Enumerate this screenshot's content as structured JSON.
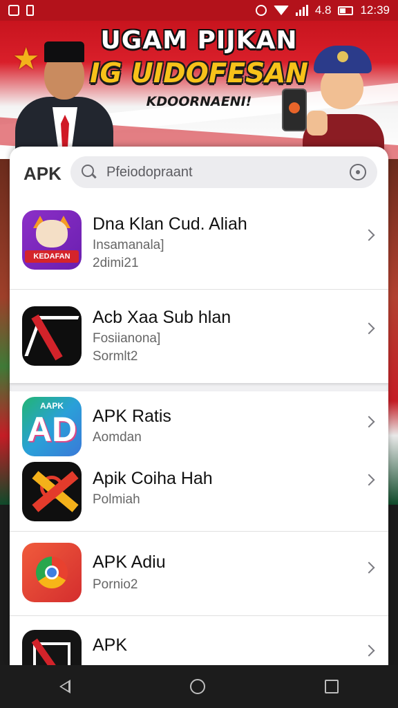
{
  "status_bar": {
    "battery_text": "4.8",
    "time": "12:39"
  },
  "banner": {
    "title": "UGAM PIJKAN",
    "subtitle": "IG UIDOFESAN",
    "tagline": "KDOORNAENI!"
  },
  "search": {
    "brand": "APK",
    "placeholder": "Pfeiodopraant"
  },
  "apps": [
    {
      "title": "Dna Klan Cud. Aliah",
      "line1": "Insamanala]",
      "line2": "2dimi21",
      "icon": "cat-mascot-icon",
      "icon_label": "KEDAFAN"
    },
    {
      "title": "Acb Xaa Sub hlan",
      "line1": "Fosiianona]",
      "line2": "Sormlt2",
      "icon": "letter-a-icon"
    },
    {
      "title": "APK Ratis",
      "line1": "Aomdan",
      "line2": "",
      "icon": "apk-ad-icon",
      "icon_top": "AAPK",
      "icon_big": "AD"
    },
    {
      "title": "Apik Coiha Hah",
      "line1": "Polmiah",
      "line2": "",
      "icon": "crossed-bands-icon"
    },
    {
      "title": "APK Adiu",
      "line1": "Pornio2",
      "line2": "",
      "icon": "chrome-like-icon"
    },
    {
      "title": "APK",
      "line1": "",
      "line2": "",
      "icon": "framed-slash-icon"
    }
  ],
  "colors": {
    "status_bar": "#b3121b",
    "banner_title": "#ffffff",
    "banner_subtitle": "#f7c21a",
    "nav_bar": "#1c1c1c"
  }
}
